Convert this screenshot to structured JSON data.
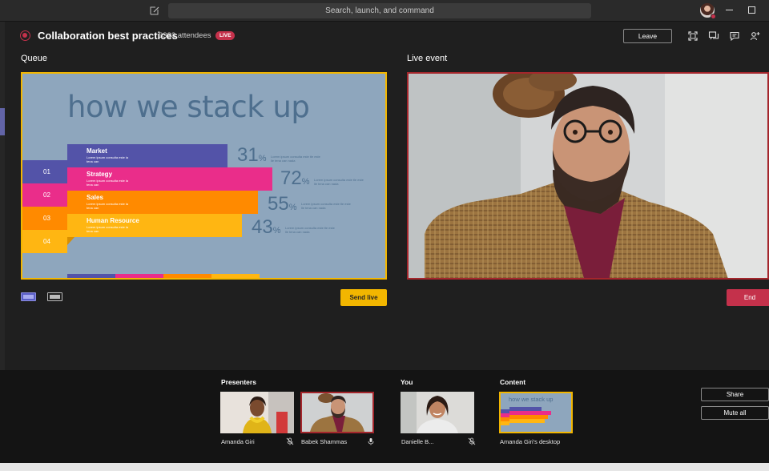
{
  "titlebar": {
    "search_placeholder": "Search, launch, and command"
  },
  "meeting": {
    "title": "Collaboration best practices",
    "attendees": "3333 attendees",
    "live_badge": "LIVE",
    "leave_label": "Leave"
  },
  "panels": {
    "queue_label": "Queue",
    "live_label": "Live event",
    "send_live_label": "Send live",
    "end_label": "End"
  },
  "slide": {
    "title": "how we stack up",
    "bars": [
      {
        "label": "Market",
        "sub": "Lorem ipsum consulta este la tena can",
        "pct": "31",
        "desc": "Lorem ipsum consulta este tle este lle tena can nada",
        "color": "#5353a8"
      },
      {
        "label": "Strategy",
        "sub": "Lorem ipsum consulta este la tena can",
        "pct": "72",
        "desc": "Lorem ipsum consulta este tle este lle tena can nada",
        "color": "#ea2d8a"
      },
      {
        "label": "Sales",
        "sub": "Lorem ipsum consulta este la tena can",
        "pct": "55",
        "desc": "Lorem ipsum consulta este tle este lle tena can nada",
        "color": "#ff8a00"
      },
      {
        "label": "Human Resource",
        "sub": "Lorem ipsum consulta este la tena can",
        "pct": "43",
        "desc": "Lorem ipsum consulta este tle este lle tena can nada",
        "color": "#ffb612"
      }
    ],
    "numbers": [
      "01",
      "02",
      "03",
      "04"
    ],
    "pct_suffix": "%"
  },
  "tray": {
    "presenters_label": "Presenters",
    "you_label": "You",
    "content_label": "Content",
    "presenters": [
      {
        "name": "Amanda Giri",
        "mic": "mic-off"
      },
      {
        "name": "Babek Shammas",
        "mic": "mic-on"
      }
    ],
    "you": {
      "name": "Danielle B...",
      "mic": "mic-off"
    },
    "content": {
      "name": "Amanda Giri's desktop",
      "thumb_title": "how we stack up"
    },
    "share_label": "Share",
    "mute_all_label": "Mute all"
  },
  "colors": {
    "accent_yellow": "#f2b600",
    "live_red": "#c4314b",
    "brand_purple": "#6264a7"
  }
}
